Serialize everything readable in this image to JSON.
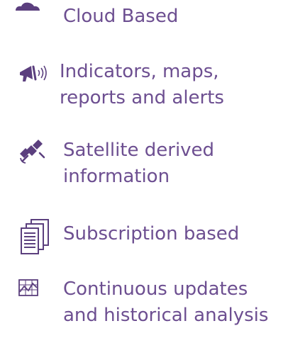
{
  "colors": {
    "text": "#6d4f91",
    "icon": "#5b3f7e",
    "background": "#ffffff"
  },
  "features": [
    {
      "icon": "cloud-icon",
      "lines": [
        "Cloud Based"
      ]
    },
    {
      "icon": "megaphone-icon",
      "lines": [
        "Indicators, maps,",
        "reports and alerts"
      ]
    },
    {
      "icon": "satellite-icon",
      "lines": [
        "Satellite derived",
        "information"
      ]
    },
    {
      "icon": "document-stack-icon",
      "lines": [
        "Subscription based"
      ]
    },
    {
      "icon": "chart-icon",
      "lines": [
        "Continuous updates",
        "and historical analysis"
      ]
    }
  ]
}
